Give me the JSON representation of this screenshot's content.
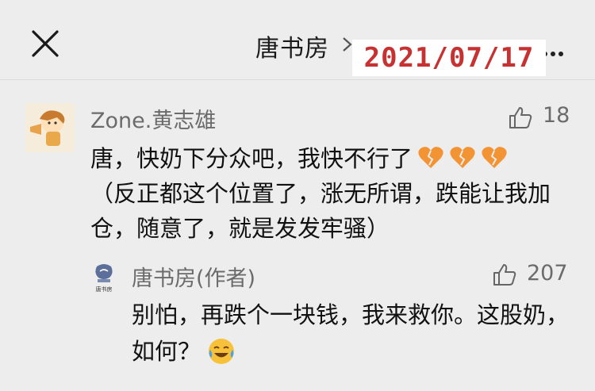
{
  "header": {
    "title": "唐书房",
    "date_stamp": "2021/07/17",
    "close_icon": "close-icon",
    "chevron_icon": "chevron-right-icon",
    "more_icon": "more-dots-icon"
  },
  "comment": {
    "username": "Zone.黄志雄",
    "likes": "18",
    "text": "唐，快奶下分众吧，我快不行了",
    "text_continued": "（反正都这个位置了，涨无所谓，跌能让我加仓，随意了，就是发发牢骚）",
    "emoji": "broken-heart-icon"
  },
  "reply": {
    "username": "唐书房(作者)",
    "avatar_label": "唐书房",
    "likes": "207",
    "text": "别怕，再跌个一块钱，我来救你。这股奶，如何？",
    "emoji": "laughing-crying-icon"
  },
  "colors": {
    "background": "#ededed",
    "date_stamp": "#c63232",
    "heart": "#f29434"
  }
}
